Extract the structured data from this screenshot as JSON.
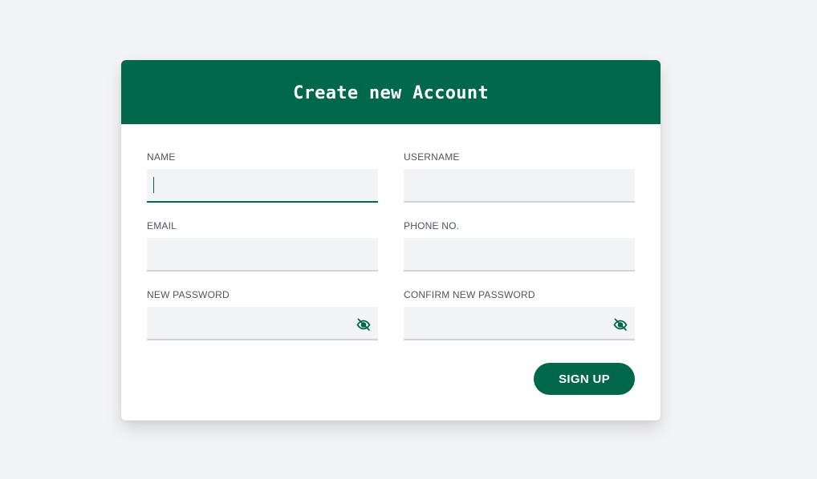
{
  "header": {
    "title": "Create new Account"
  },
  "form": {
    "fields": [
      {
        "label": "NAME",
        "value": "",
        "type": "text",
        "focused": true
      },
      {
        "label": "USERNAME",
        "value": "",
        "type": "text"
      },
      {
        "label": "EMAIL",
        "value": "",
        "type": "email"
      },
      {
        "label": "PHONE NO.",
        "value": "",
        "type": "tel"
      },
      {
        "label": "NEW PASSWORD",
        "value": "",
        "type": "password",
        "icon": "eye-off-icon"
      },
      {
        "label": "CONFIRM NEW PASSWORD",
        "value": "",
        "type": "password",
        "icon": "eye-off-icon"
      }
    ],
    "submit_label": "SIGN UP"
  },
  "colors": {
    "accent": "#00684a",
    "page_background": "#f3f4f6",
    "input_background": "#f3f4f6",
    "input_border": "#d1d5db",
    "label_text": "#4b5563"
  }
}
